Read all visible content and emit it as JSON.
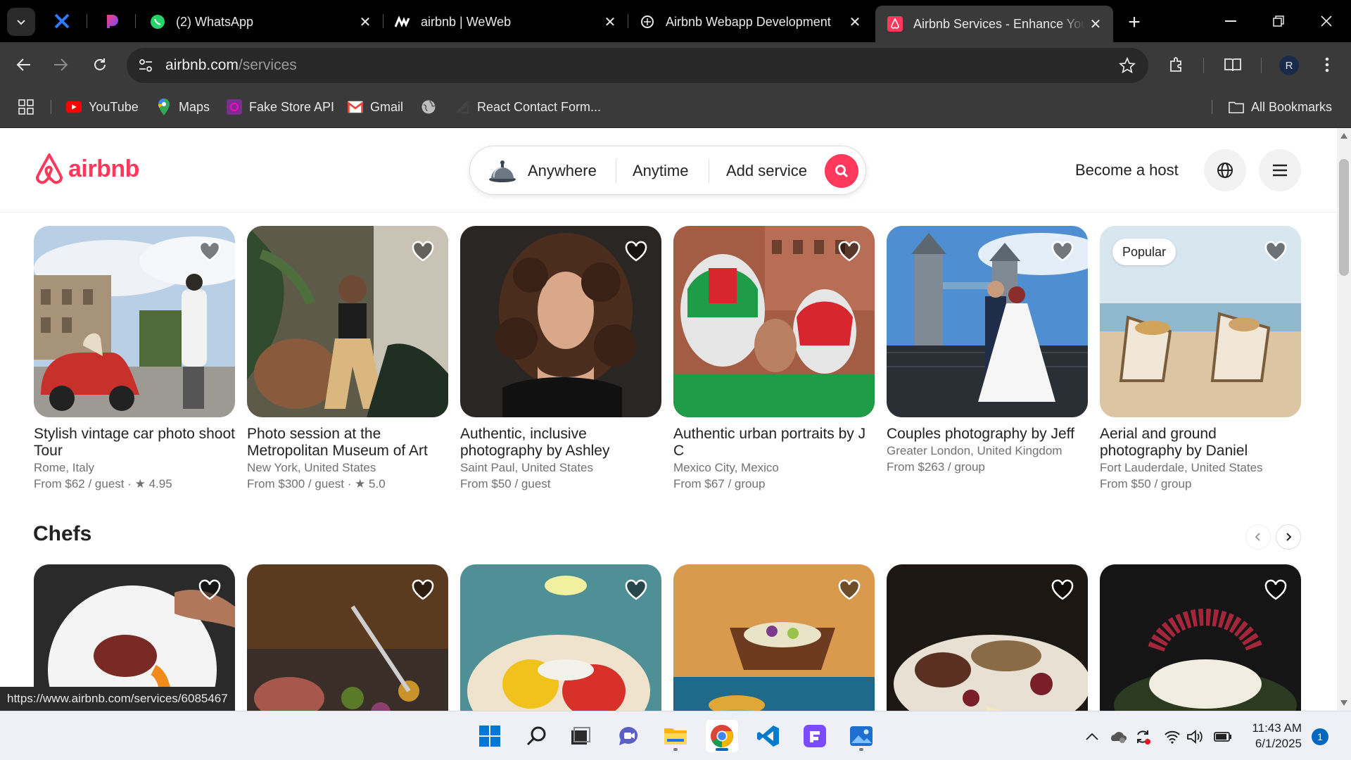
{
  "browser": {
    "tabs": [
      {
        "title": "(2) WhatsApp",
        "icon": "whatsapp-icon"
      },
      {
        "title": "airbnb | WeWeb",
        "icon": "weweb-icon"
      },
      {
        "title": "Airbnb Webapp Development",
        "icon": "openai-icon"
      },
      {
        "title": "Airbnb Services - Enhance Your",
        "icon": "airbnb-icon",
        "active": true
      }
    ],
    "url_host": "airbnb.com",
    "url_path": "/services",
    "bookmarks": [
      {
        "label": "YouTube",
        "icon": "youtube-icon"
      },
      {
        "label": "Maps",
        "icon": "maps-icon"
      },
      {
        "label": "Fake Store API",
        "icon": "fake-store-icon"
      },
      {
        "label": "Gmail",
        "icon": "gmail-icon"
      },
      {
        "label": "",
        "icon": "globe-icon"
      },
      {
        "label": "React Contact Form...",
        "icon": "react-form-icon"
      }
    ],
    "all_bookmarks": "All Bookmarks",
    "profile_initial": "R",
    "status_url": "https://www.airbnb.com/services/6085467"
  },
  "header": {
    "logo_text": "airbnb",
    "search": {
      "where": "Anywhere",
      "when": "Anytime",
      "what": "Add service"
    },
    "become_host": "Become a host"
  },
  "cards": [
    {
      "title": "Stylish vintage car photo shoot Tour",
      "location": "Rome, Italy",
      "price": "From $62 / guest",
      "rating": "★ 4.95"
    },
    {
      "title": "Photo session at the Metropolitan Museum of Art",
      "location": "New York, United States",
      "price": "From $300 / guest",
      "rating": "★ 5.0"
    },
    {
      "title": "Authentic, inclusive photography by Ashley",
      "location": "Saint Paul, United States",
      "price": "From $50 / guest",
      "rating": ""
    },
    {
      "title": "Authentic urban portraits by J C",
      "location": "Mexico City, Mexico",
      "price": "From $67 / group",
      "rating": ""
    },
    {
      "title": "Couples photography by Jeff",
      "location": "Greater London, United Kingdom",
      "price": "From $263 / group",
      "rating": ""
    },
    {
      "title": "Aerial and ground photography by Daniel",
      "location": "Fort Lauderdale, United States",
      "price": "From $50 / group",
      "rating": "",
      "badge": "Popular"
    }
  ],
  "chefs": {
    "title": "Chefs"
  },
  "taskbar": {
    "apps": [
      "windows-start",
      "search",
      "task-view",
      "teams-chat",
      "file-explorer",
      "chrome",
      "vscode",
      "figma",
      "photos"
    ],
    "time": "11:43 AM",
    "date": "6/1/2025",
    "notifications": "1"
  },
  "colors": {
    "brand": "#ff385c",
    "chrome_dark": "#3a3a3a"
  }
}
